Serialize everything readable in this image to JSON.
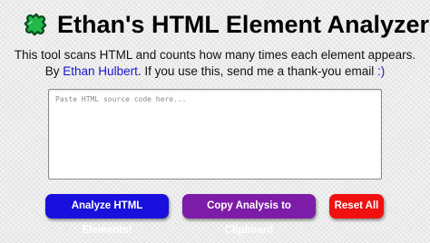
{
  "header": {
    "logo_icon": "green-puzzle-piece-icon",
    "title": "Ethan's HTML Element Analyzer"
  },
  "intro": {
    "line1": "This tool scans HTML and counts how many times each element appears.",
    "by_prefix": "By ",
    "author_link": "Ethan Hulbert",
    "line2_rest": ". If you use this, send me a thank-you email ",
    "smiley_link": ":)"
  },
  "input": {
    "placeholder": "Paste HTML source code here...",
    "value": ""
  },
  "buttons": {
    "analyze": "Analyze HTML Elements!",
    "copy": "Copy Analysis to Clipboard",
    "reset": "Reset All"
  },
  "colors": {
    "analyze_button": "#1a10dd",
    "copy_button": "#7d1ca8",
    "reset_button": "#f01010",
    "link": "#1a14c8",
    "logo_green": "#22b84a"
  }
}
